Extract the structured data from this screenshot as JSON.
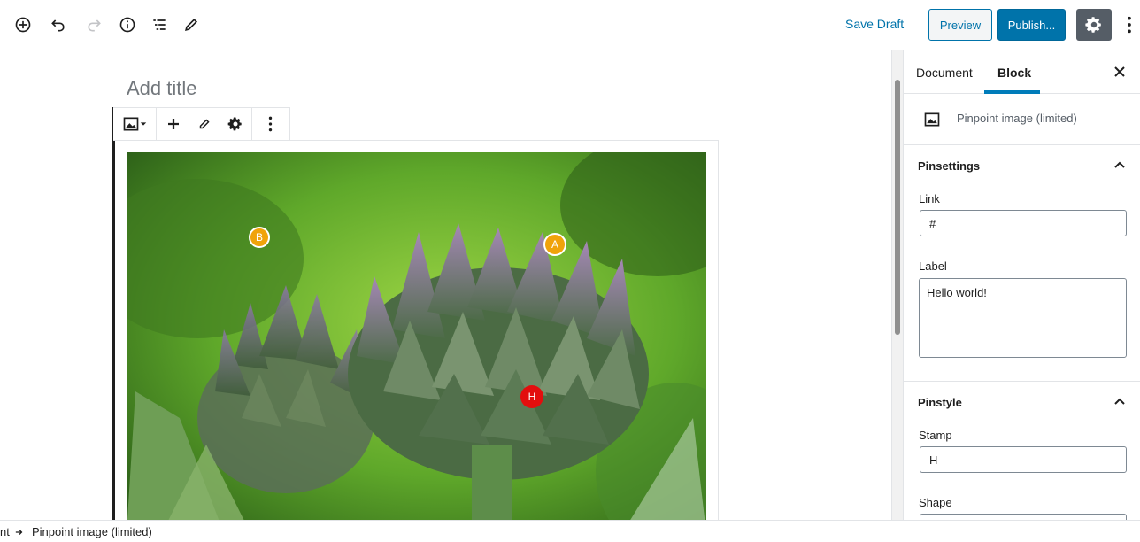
{
  "topbar": {
    "icons": [
      "add-block-icon",
      "undo-icon",
      "redo-icon",
      "info-icon",
      "outline-icon",
      "edit-icon"
    ],
    "save_draft": "Save Draft",
    "preview": "Preview",
    "publish": "Publish..."
  },
  "editor": {
    "title_placeholder": "Add title",
    "pins": [
      {
        "label": "B",
        "color": "#f0a30a"
      },
      {
        "label": "A",
        "color": "#f0a30a"
      },
      {
        "label": "H",
        "color": "#e30e0e"
      }
    ]
  },
  "sidebar": {
    "tabs": [
      {
        "label": "Document"
      },
      {
        "label": "Block"
      }
    ],
    "block_name": "Pinpoint image (limited)",
    "pin_settings": {
      "heading": "Pinsettings",
      "link_label": "Link",
      "link_value": "#",
      "label_label": "Label",
      "label_value": "Hello world!"
    },
    "pin_style": {
      "heading": "Pinstyle",
      "stamp_label": "Stamp",
      "stamp_value": "H",
      "shape_label": "Shape"
    }
  },
  "footer": {
    "crumb_first": "nt",
    "crumb_second": "Pinpoint image (limited)"
  },
  "colors": {
    "accent": "#0073aa",
    "tab_accent": "#007cba",
    "settings_bg": "#555d66"
  }
}
